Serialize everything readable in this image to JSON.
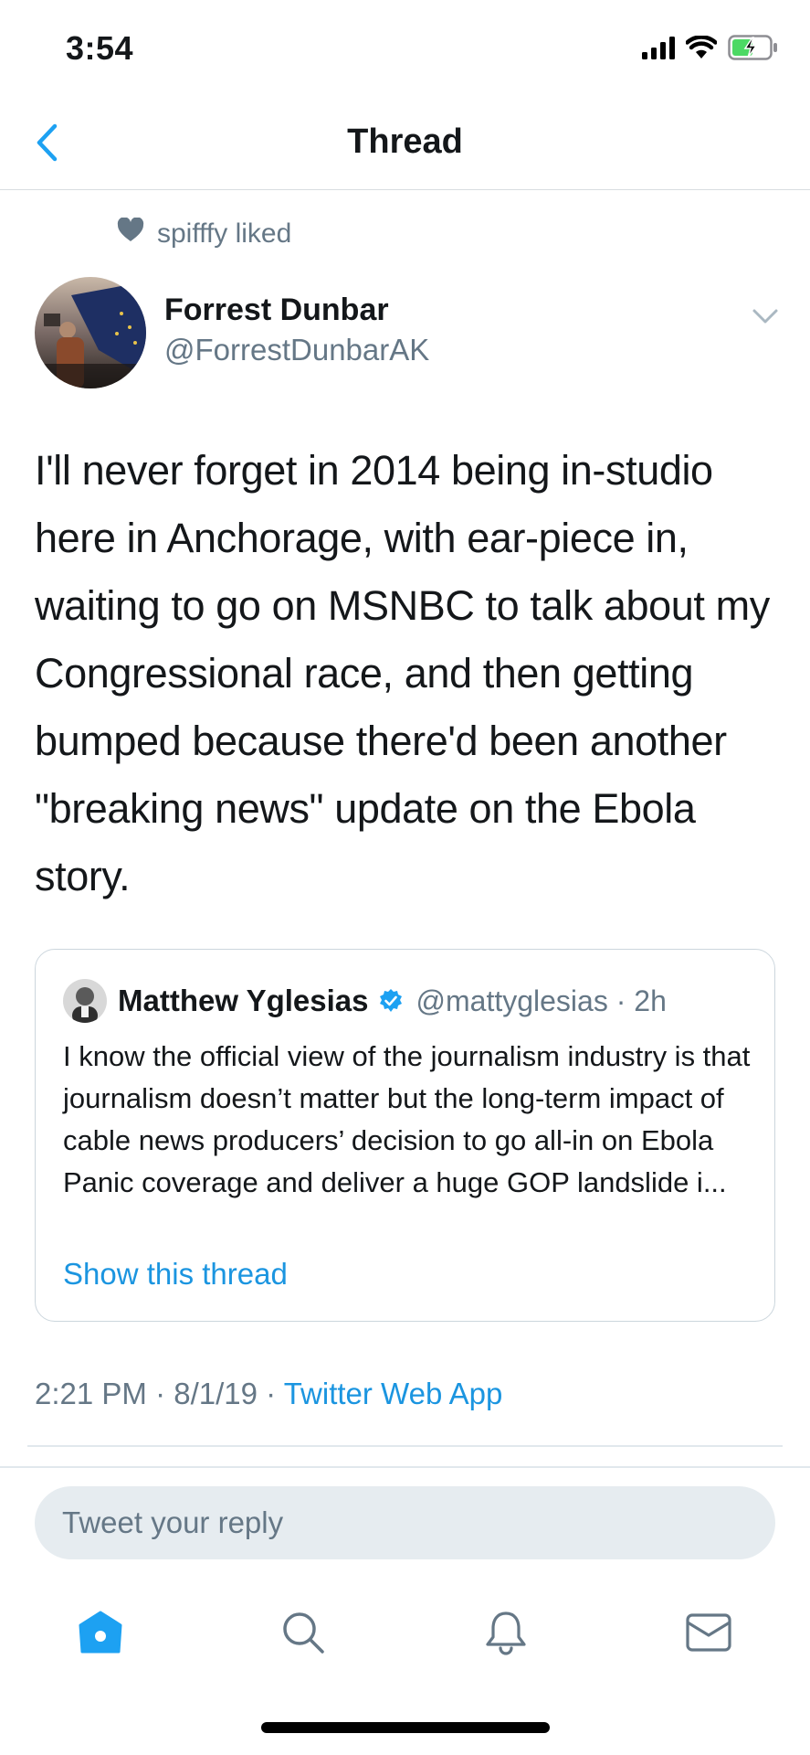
{
  "status_bar": {
    "time": "3:54",
    "icons": [
      "signal-icon",
      "wifi-icon",
      "battery-charging-icon"
    ]
  },
  "nav": {
    "title": "Thread",
    "back_icon": "chevron-left-icon"
  },
  "social_context": {
    "icon": "heart-icon",
    "text": "spifffy liked"
  },
  "tweet": {
    "author_name": "Forrest Dunbar",
    "author_handle": "@ForrestDunbarAK",
    "text": "I'll never forget in 2014 being in-studio here in Anchorage, with ear-piece in, waiting to go on MSNBC to talk about my Congressional race, and then getting bumped because there'd been another \"breaking news\" update on the Ebola story.",
    "timestamp": "2:21 PM · 8/1/19 · ",
    "source_app": "Twitter Web App"
  },
  "quote": {
    "author_name": "Matthew Yglesias",
    "author_handle": "@mattyglesias · 2h",
    "text": "I know the official view of the journalism industry is that journalism doesn’t matter but the long-term impact of cable news producers’ decision to go all-in on Ebola Panic coverage and deliver a huge GOP landslide i...",
    "show_thread": "Show this thread"
  },
  "reply": {
    "placeholder": "Tweet your reply"
  },
  "tabs": [
    {
      "name": "home",
      "icon": "home-icon",
      "active": true
    },
    {
      "name": "search",
      "icon": "search-icon",
      "active": false
    },
    {
      "name": "notifications",
      "icon": "bell-icon",
      "active": false
    },
    {
      "name": "messages",
      "icon": "mail-icon",
      "active": false
    }
  ],
  "colors": {
    "accent": "#1da1f2",
    "link": "#1b95e0",
    "secondary_text": "#657786",
    "reply_bg": "#e6ecf0"
  }
}
